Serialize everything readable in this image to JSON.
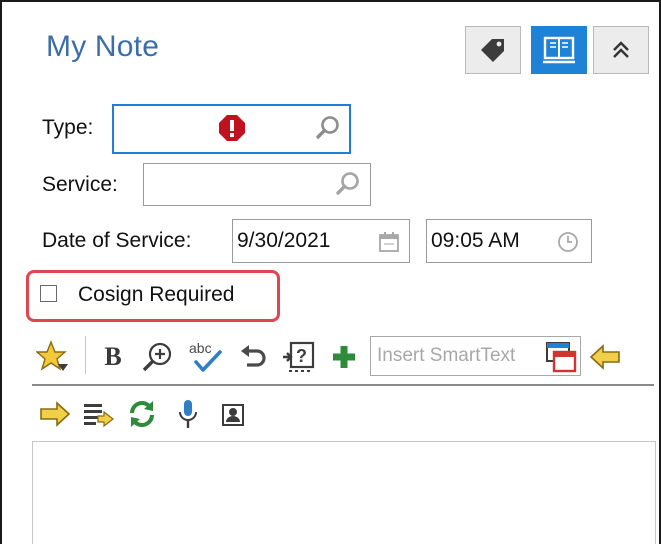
{
  "note": {
    "title": "My Note"
  },
  "header_buttons": {
    "tag": "tag-icon",
    "sidebyside": "book-icon",
    "collapse": "double-chevron-up-icon"
  },
  "form": {
    "type_label": "Type:",
    "service_label": "Service:",
    "date_label": "Date of Service:",
    "date_value": "9/30/2021",
    "time_value": "09:05 AM",
    "cosign_label": "Cosign Required",
    "cosign_checked": false
  },
  "toolbar": {
    "bold_label": "B",
    "smarttext_placeholder": "Insert SmartText",
    "spell_label": "abc"
  },
  "colors": {
    "title": "#3b6ea8",
    "focus_border": "#1e7fd9",
    "error": "#c0111f",
    "highlight": "#e0464f",
    "active_button": "#1e82d6"
  }
}
